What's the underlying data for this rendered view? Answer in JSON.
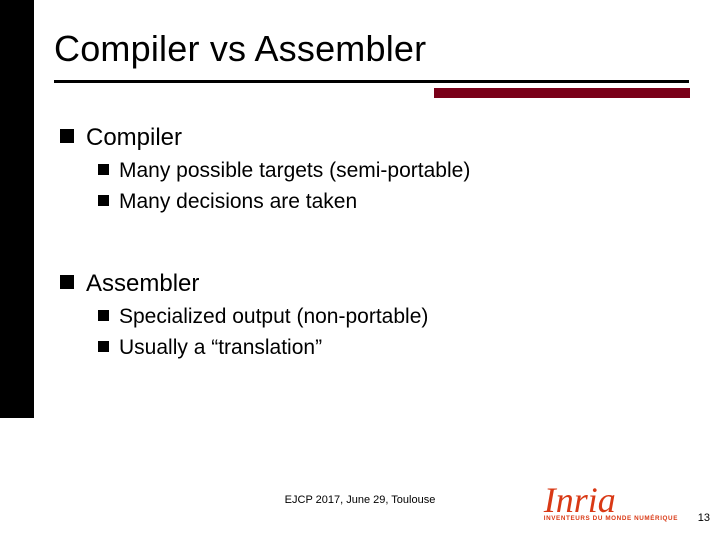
{
  "title": "Compiler vs Assembler",
  "groups": [
    {
      "heading": "Compiler",
      "items": [
        "Many possible targets (semi-portable)",
        "Many decisions are taken"
      ]
    },
    {
      "heading": "Assembler",
      "items": [
        "Specialized output (non-portable)",
        "Usually a “translation”"
      ]
    }
  ],
  "footer": "EJCP 2017, June 29, Toulouse",
  "logo": {
    "word": "Inria",
    "tagline": "INVENTEURS DU MONDE NUMÉRIQUE"
  },
  "page": "13",
  "colors": {
    "accent": "#7a0019",
    "logo": "#d93915"
  }
}
